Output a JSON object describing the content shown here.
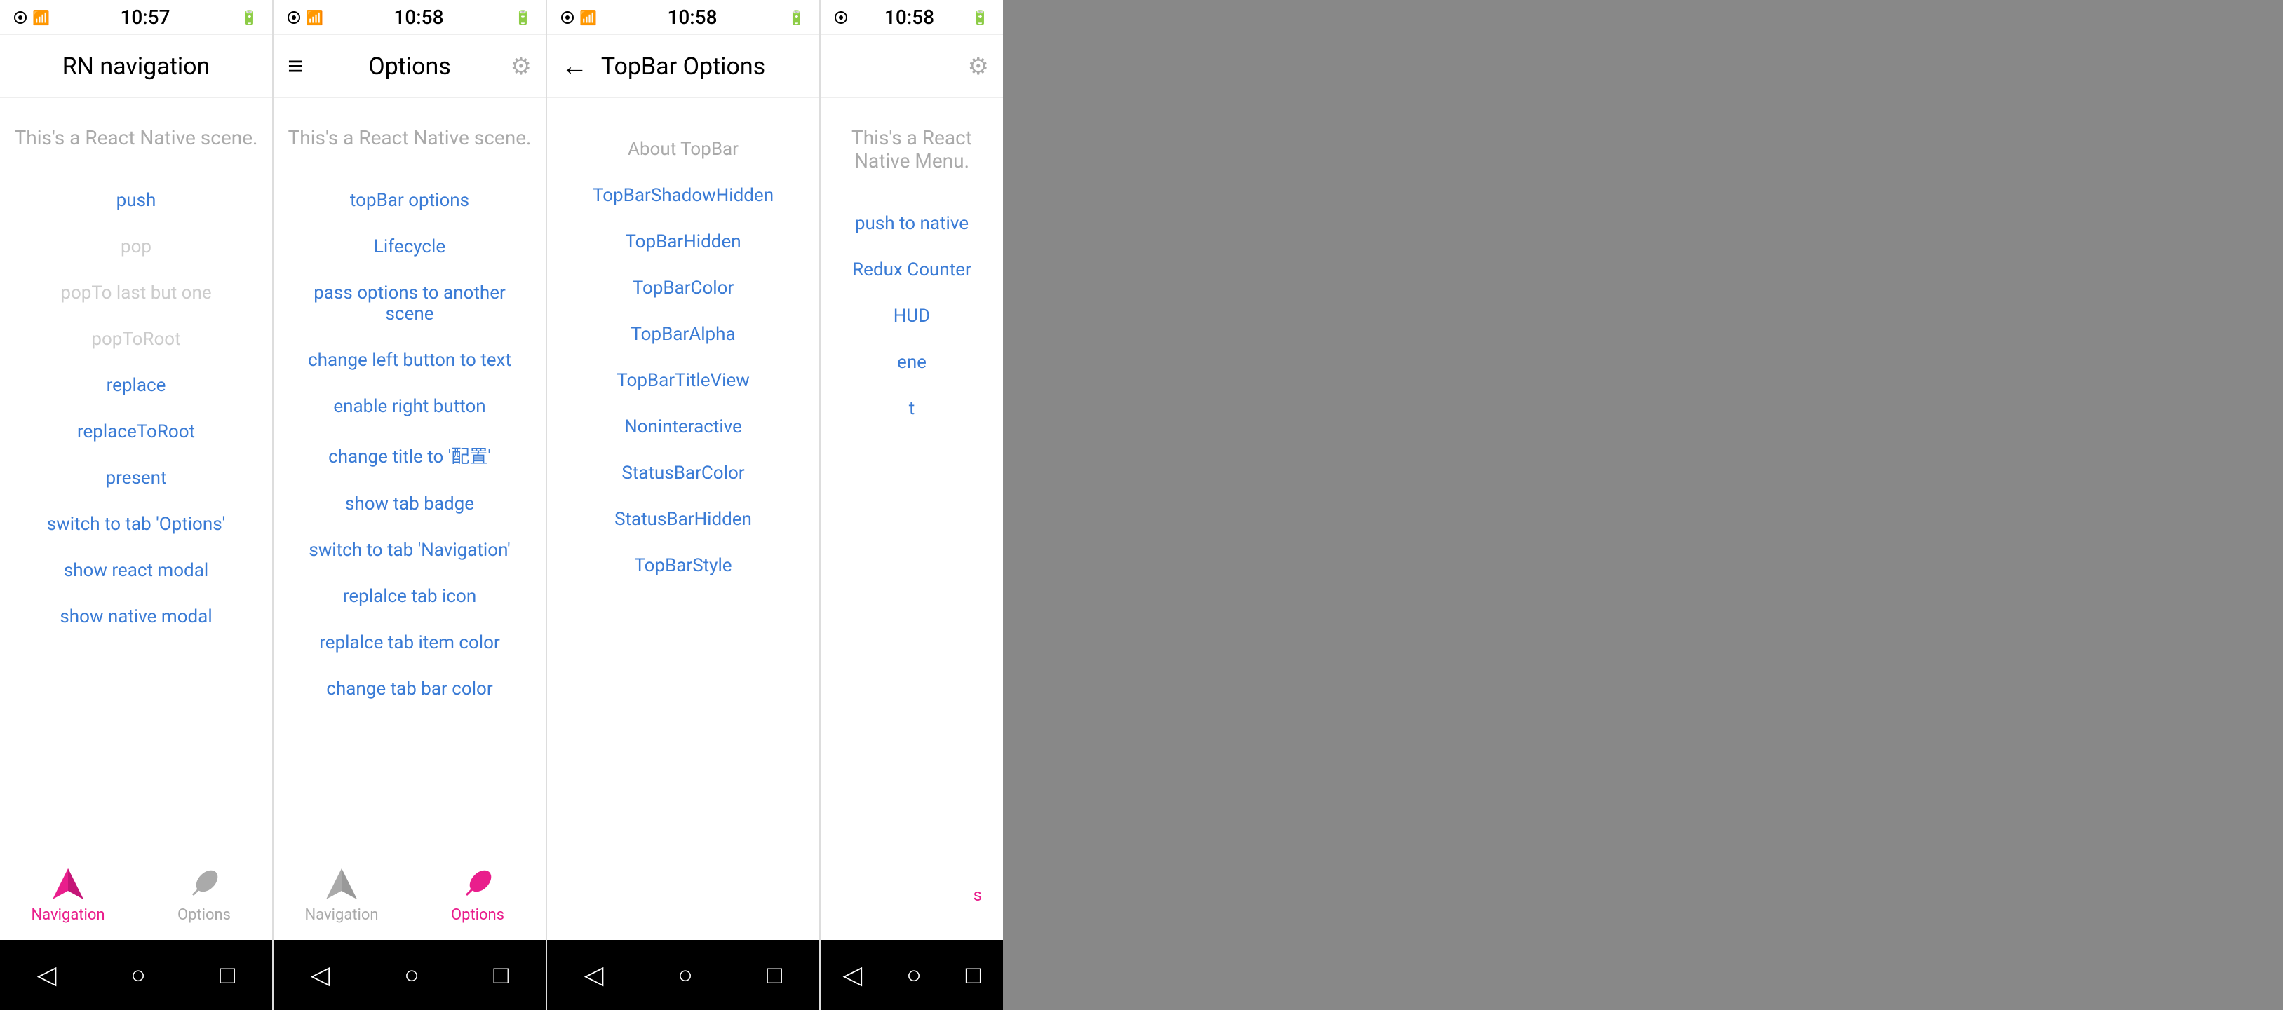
{
  "screen1": {
    "statusBar": {
      "time": "10:57"
    },
    "topBar": {
      "title": "RN navigation"
    },
    "sceneText": "This's a React Native scene.",
    "links": [
      {
        "label": "push",
        "disabled": false
      },
      {
        "label": "pop",
        "disabled": true
      },
      {
        "label": "popTo last but one",
        "disabled": true
      },
      {
        "label": "popToRoot",
        "disabled": true
      },
      {
        "label": "replace",
        "disabled": false
      },
      {
        "label": "replaceToRoot",
        "disabled": false
      },
      {
        "label": "present",
        "disabled": false
      },
      {
        "label": "switch to tab 'Options'",
        "disabled": false
      },
      {
        "label": "show react modal",
        "disabled": false
      },
      {
        "label": "show native modal",
        "disabled": false
      }
    ],
    "tabs": [
      {
        "label": "Navigation",
        "active": true
      },
      {
        "label": "Options",
        "active": false
      }
    ]
  },
  "screen2": {
    "statusBar": {
      "time": "10:58"
    },
    "topBar": {
      "title": "Options",
      "hasMenu": true,
      "hasSettings": true
    },
    "sceneText": "This's a React Native scene.",
    "links": [
      {
        "label": "topBar options",
        "disabled": false
      },
      {
        "label": "Lifecycle",
        "disabled": false
      },
      {
        "label": "pass options to another scene",
        "disabled": false
      },
      {
        "label": "change left button to text",
        "disabled": false
      },
      {
        "label": "enable right button",
        "disabled": false
      },
      {
        "label": "change title to '配置'",
        "disabled": false
      },
      {
        "label": "show tab badge",
        "disabled": false
      },
      {
        "label": "switch to tab 'Navigation'",
        "disabled": false
      },
      {
        "label": "replalce tab icon",
        "disabled": false
      },
      {
        "label": "replalce tab item color",
        "disabled": false
      },
      {
        "label": "change tab bar color",
        "disabled": false
      }
    ],
    "tabs": [
      {
        "label": "Navigation",
        "active": false
      },
      {
        "label": "Options",
        "active": true
      }
    ]
  },
  "screen3": {
    "statusBar": {
      "time": "10:58"
    },
    "topBar": {
      "title": "TopBar Options",
      "hasBack": true
    },
    "sectionHeader": "About TopBar",
    "links": [
      {
        "label": "TopBarShadowHidden",
        "disabled": false
      },
      {
        "label": "TopBarHidden",
        "disabled": false
      },
      {
        "label": "TopBarColor",
        "disabled": false
      },
      {
        "label": "TopBarAlpha",
        "disabled": false
      },
      {
        "label": "TopBarTitleView",
        "disabled": false
      },
      {
        "label": "Noninteractive",
        "disabled": false
      },
      {
        "label": "StatusBarColor",
        "disabled": false
      },
      {
        "label": "StatusBarHidden",
        "disabled": false
      },
      {
        "label": "TopBarStyle",
        "disabled": false
      }
    ]
  },
  "screen4": {
    "statusBar": {
      "time": "10:58"
    },
    "topBar": {
      "title": ""
    },
    "sceneText": "This's a React Native Menu.",
    "links": [
      {
        "label": "push to native",
        "disabled": false
      },
      {
        "label": "Redux Counter",
        "disabled": false
      },
      {
        "label": "HUD",
        "disabled": false
      }
    ]
  },
  "icons": {
    "menu": "≡",
    "settings": "⚙",
    "back": "←",
    "back_nav": "◁",
    "circle": "○",
    "square": "□"
  }
}
